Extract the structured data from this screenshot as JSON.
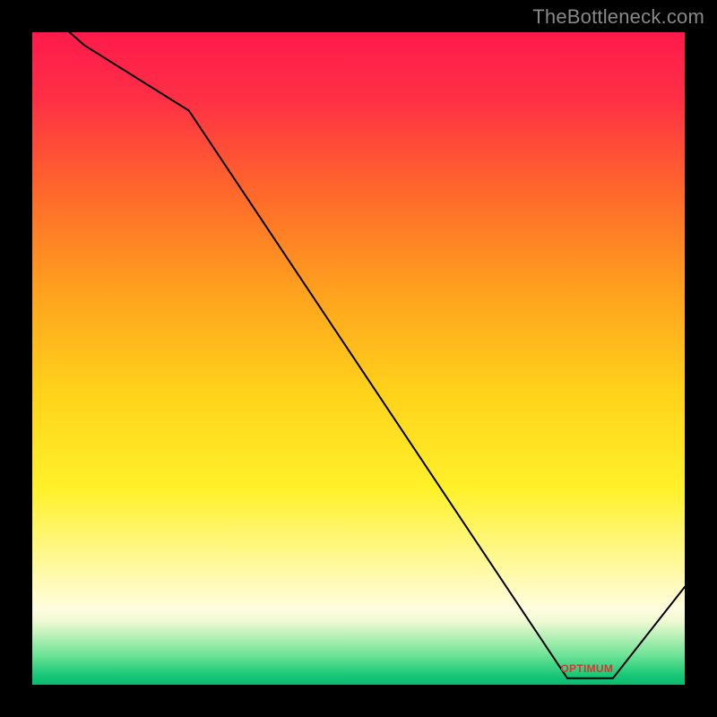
{
  "watermark": "TheBottleneck.com",
  "optimum_label": "OPTIMUM",
  "chart_data": {
    "type": "line",
    "title": "",
    "xlabel": "",
    "ylabel": "",
    "xlim": [
      0,
      100
    ],
    "ylim": [
      0,
      100
    ],
    "grid": false,
    "x": [
      0,
      8,
      24,
      82,
      89,
      100
    ],
    "values": [
      105,
      98,
      88,
      1,
      1,
      15
    ],
    "optimum_x": 85,
    "gradient_stops": [
      {
        "pos": 0.0,
        "color": "#ff1a4b"
      },
      {
        "pos": 0.1,
        "color": "#ff2f45"
      },
      {
        "pos": 0.25,
        "color": "#ff6a2a"
      },
      {
        "pos": 0.4,
        "color": "#ffa21e"
      },
      {
        "pos": 0.55,
        "color": "#ffd21a"
      },
      {
        "pos": 0.7,
        "color": "#fff12a"
      },
      {
        "pos": 0.82,
        "color": "#fff9a0"
      },
      {
        "pos": 0.885,
        "color": "#fffde0"
      },
      {
        "pos": 0.905,
        "color": "#eaf9cf"
      },
      {
        "pos": 0.955,
        "color": "#6de396"
      },
      {
        "pos": 0.985,
        "color": "#18c978"
      },
      {
        "pos": 1.0,
        "color": "#0db86f"
      }
    ]
  }
}
